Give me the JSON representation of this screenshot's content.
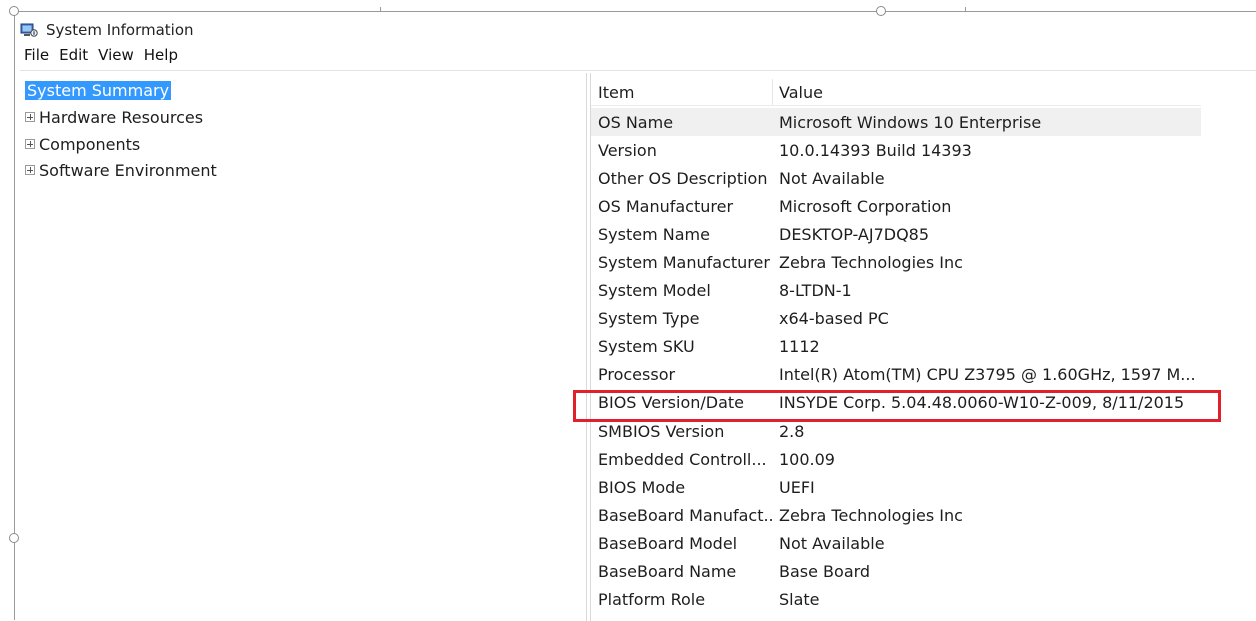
{
  "window": {
    "title": "System Information"
  },
  "menu": [
    "File",
    "Edit",
    "View",
    "Help"
  ],
  "tree": {
    "selected": "System Summary",
    "items": [
      "Hardware Resources",
      "Components",
      "Software Environment"
    ]
  },
  "list": {
    "headers": {
      "item": "Item",
      "value": "Value"
    },
    "rows": [
      {
        "item": "OS Name",
        "value": "Microsoft Windows 10 Enterprise"
      },
      {
        "item": "Version",
        "value": "10.0.14393 Build 14393"
      },
      {
        "item": "Other OS Description",
        "value": "Not Available"
      },
      {
        "item": "OS Manufacturer",
        "value": "Microsoft Corporation"
      },
      {
        "item": "System Name",
        "value": "DESKTOP-AJ7DQ85"
      },
      {
        "item": "System Manufacturer",
        "value": "Zebra Technologies Inc"
      },
      {
        "item": "System Model",
        "value": "8-LTDN-1"
      },
      {
        "item": "System Type",
        "value": "x64-based PC"
      },
      {
        "item": "System SKU",
        "value": "1112"
      },
      {
        "item": "Processor",
        "value": "Intel(R) Atom(TM) CPU  Z3795  @ 1.60GHz, 1597 M..."
      },
      {
        "item": "BIOS Version/Date",
        "value": "INSYDE Corp. 5.04.48.0060-W10-Z-009, 8/11/2015"
      },
      {
        "item": "SMBIOS Version",
        "value": "2.8"
      },
      {
        "item": "Embedded Controll...",
        "value": "100.09"
      },
      {
        "item": "BIOS Mode",
        "value": "UEFI"
      },
      {
        "item": "BaseBoard Manufact...",
        "value": "Zebra Technologies Inc"
      },
      {
        "item": "BaseBoard Model",
        "value": "Not Available"
      },
      {
        "item": "BaseBoard Name",
        "value": "Base Board"
      },
      {
        "item": "Platform Role",
        "value": "Slate"
      }
    ]
  },
  "annotation": {
    "color": "#e0202a",
    "highlighted_row": "BIOS Version/Date"
  },
  "colors": {
    "selection": "#3399ff"
  }
}
